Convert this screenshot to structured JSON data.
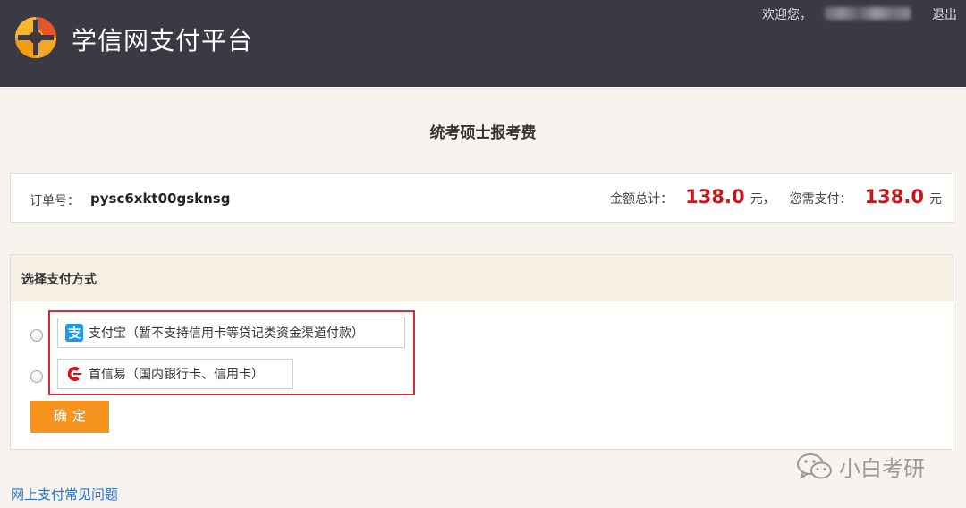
{
  "header": {
    "site_title": "学信网支付平台",
    "welcome": "欢迎您，",
    "logout": "退出"
  },
  "page": {
    "heading": "统考硕士报考费"
  },
  "order": {
    "label": "订单号：",
    "number": "pysc6xkt00gsknsg",
    "total_label": "金额总计：",
    "total_value": "138.0",
    "total_unit": "元，",
    "pay_label": "您需支付：",
    "pay_value": "138.0",
    "pay_unit": "元"
  },
  "payment": {
    "section_title": "选择支付方式",
    "options": [
      {
        "label": "支付宝（暂不支持信用卡等贷记类资金渠道付款）",
        "icon": "alipay-icon",
        "selected": false
      },
      {
        "label": "首信易（国内银行卡、信用卡）",
        "icon": "payease-icon",
        "selected": false
      }
    ],
    "confirm_label": "确定"
  },
  "footer": {
    "faq_link": "网上支付常见问题",
    "watermark": "小白考研"
  },
  "colors": {
    "header_bg": "#3a3a44",
    "amount_red": "#c8161d",
    "confirm_orange": "#f7941d",
    "highlight_red": "#d42d37",
    "link_blue": "#2a6fc9"
  }
}
